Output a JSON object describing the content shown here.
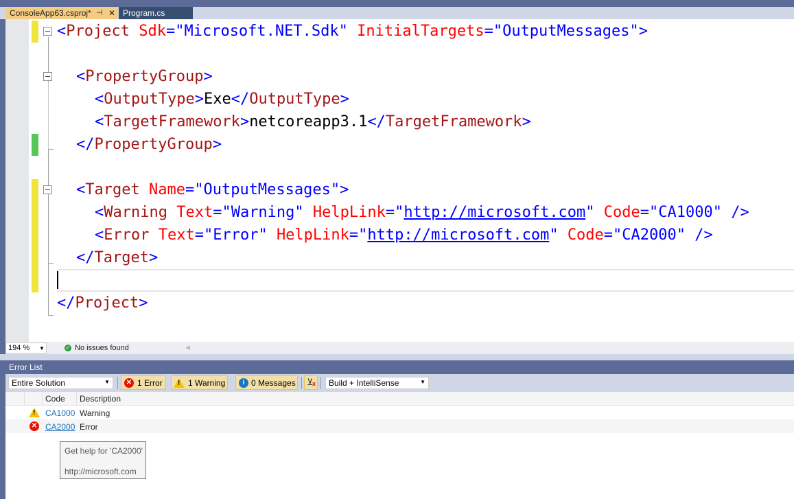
{
  "tabs": [
    {
      "label": "ConsoleApp63.csproj*",
      "active": true,
      "pin_icon": "pin-icon",
      "close_icon": "close-icon"
    },
    {
      "label": "Program.cs",
      "active": false
    }
  ],
  "editor": {
    "lines": {
      "l1": {
        "open": "<",
        "tag": "Project",
        "a1": "Sdk",
        "eq1": "=",
        "v1": "\"Microsoft.NET.Sdk\"",
        "a2": "InitialTargets",
        "eq2": "=",
        "v2": "\"OutputMessages\"",
        "close": ">"
      },
      "l3": {
        "open": "<",
        "tag": "PropertyGroup",
        "close": ">"
      },
      "l4": {
        "open": "<",
        "tag": "OutputType",
        "close": ">",
        "text": "Exe",
        "endopen": "</",
        "endtag": "OutputType",
        "endclose": ">"
      },
      "l5": {
        "open": "<",
        "tag": "TargetFramework",
        "close": ">",
        "text": "netcoreapp3.1",
        "endopen": "</",
        "endtag": "TargetFramework",
        "endclose": ">"
      },
      "l6": {
        "open": "</",
        "tag": "PropertyGroup",
        "close": ">"
      },
      "l8": {
        "open": "<",
        "tag": "Target",
        "a1": "Name",
        "eq1": "=",
        "v1": "\"OutputMessages\"",
        "close": ">"
      },
      "l9": {
        "open": "<",
        "tag": "Warning",
        "a1": "Text",
        "eq1": "=",
        "v1": "\"Warning\"",
        "a2": "HelpLink",
        "eq2": "=",
        "q": "\"",
        "link": "http://microsoft.com",
        "a3": "Code",
        "eq3": "=",
        "v3": "\"CA1000\"",
        "close": "/>"
      },
      "l10": {
        "open": "<",
        "tag": "Error",
        "a1": "Text",
        "eq1": "=",
        "v1": "\"Error\"",
        "a2": "HelpLink",
        "eq2": "=",
        "q": "\"",
        "link": "http://microsoft.com",
        "a3": "Code",
        "eq3": "=",
        "v3": "\"CA2000\"",
        "close": "/>"
      },
      "l11": {
        "open": "</",
        "tag": "Target",
        "close": ">"
      },
      "l13": {
        "open": "</",
        "tag": "Project",
        "close": ">"
      }
    },
    "status": {
      "zoom": "194 %",
      "issues": "No issues found",
      "issues_icon": "check-circle-icon"
    }
  },
  "error_list": {
    "title": "Error List",
    "scope": "Entire Solution",
    "errors_button": "1 Error",
    "warnings_button": "1 Warning",
    "messages_button": "0 Messages",
    "filter_icon": "filter-clear-icon",
    "build_source": "Build + IntelliSense",
    "columns": {
      "code": "Code",
      "description": "Description"
    },
    "rows": [
      {
        "severity": "warning",
        "icon": "warning-icon",
        "code": "CA1000",
        "description": "Warning"
      },
      {
        "severity": "error",
        "icon": "error-icon",
        "code": "CA2000",
        "description": "Error"
      }
    ]
  },
  "tooltip": {
    "title": "Get help for 'CA2000'",
    "url": "http://microsoft.com"
  },
  "colors": {
    "tab_active": "#f5cc84",
    "chrome": "#5d6b99",
    "element": "#a31515",
    "attribute": "#ff0000",
    "value": "#0000ff"
  }
}
